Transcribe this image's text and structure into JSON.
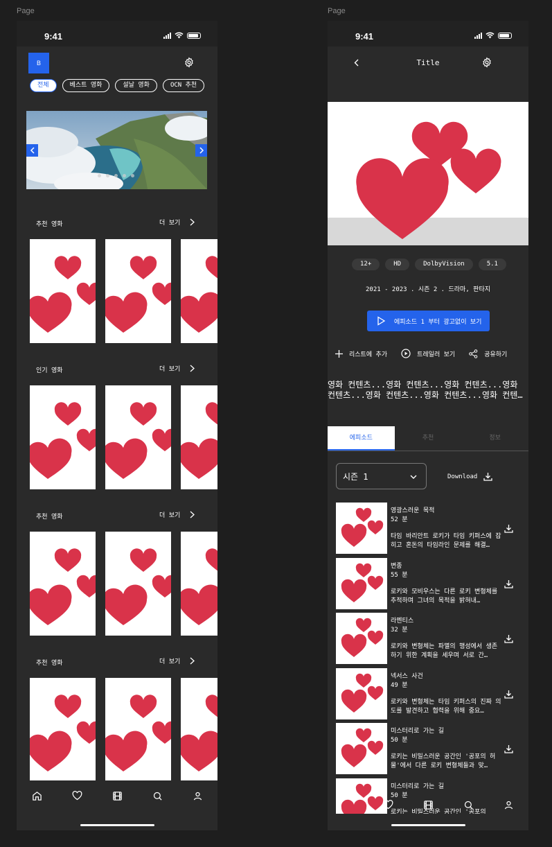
{
  "canvas": {
    "left_label": "Page",
    "right_label": "Page"
  },
  "status": {
    "time": "9:41"
  },
  "home": {
    "logo": "B",
    "chips": [
      "전체",
      "베스트 영화",
      "설날 영화",
      "OCN 추천"
    ],
    "sections": [
      {
        "title": "추천 영화",
        "more": "더 보기"
      },
      {
        "title": "인기 영화",
        "more": "더 보기"
      },
      {
        "title": "추천 영화",
        "more": "더 보기"
      },
      {
        "title": "추천 영화",
        "more": "더 보기"
      }
    ],
    "tabs": [
      "home-icon",
      "heart-icon",
      "film-icon",
      "search-icon",
      "user-icon"
    ]
  },
  "detail": {
    "title": "Title",
    "badges": [
      "12+",
      "HD",
      "DolbyVision",
      "5.1"
    ],
    "meta": "2021 - 2023  .  시즌 2  .  드라마, 판타지",
    "play_label": "에피소드 1 부터 광고없이 보기",
    "actions": {
      "add": "리스트에 추가",
      "trailer": "트레일러 보기",
      "share": "공유하기"
    },
    "description": "영화 컨텐츠...영화 컨텐츠...영화 컨텐츠...영화 컨텐츠...영화 컨텐츠...영화 컨텐츠...영화 컨텐…",
    "tabs": [
      "에피소드",
      "추천",
      "정보"
    ],
    "season": "시즌 1",
    "download_label": "Download",
    "episodes": [
      {
        "title": "영광스러운 목적",
        "length": "52 분",
        "desc": "타임 바리안트 로키가 타임 키퍼스에 잡히고 혼돈의 타임라인 문제를 해결…"
      },
      {
        "title": "변종",
        "length": "55 분",
        "desc": "로키와 모비우스는 다른 로키 변형체를 추적하며 그녀의 목적을 밝혀내…"
      },
      {
        "title": "라멘티스",
        "length": "32 분",
        "desc": "로키와 변형체는 파멸의 행성에서 생존하기 위한 계획을 세우며 서로 간…"
      },
      {
        "title": "넥서스 사건",
        "length": "49 분",
        "desc": "로키와 변형체는 타임 키퍼스의 진짜 의도를 발견하고 협력을 위해 중요…"
      },
      {
        "title": "미스터리로 가는 길",
        "length": "50 분",
        "desc": "로키는 비밀스러운 공간인 '공포의 허물'에서 다른 로키 변형체들과 맞…"
      },
      {
        "title": "미스터리로 가는 길",
        "length": "50 분",
        "desc": "로키는 비밀스러운 공간인 '공포의"
      }
    ]
  },
  "colors": {
    "accent": "#2463eb",
    "frame_bg": "#2a2a2a",
    "heart": "#d9334a"
  }
}
